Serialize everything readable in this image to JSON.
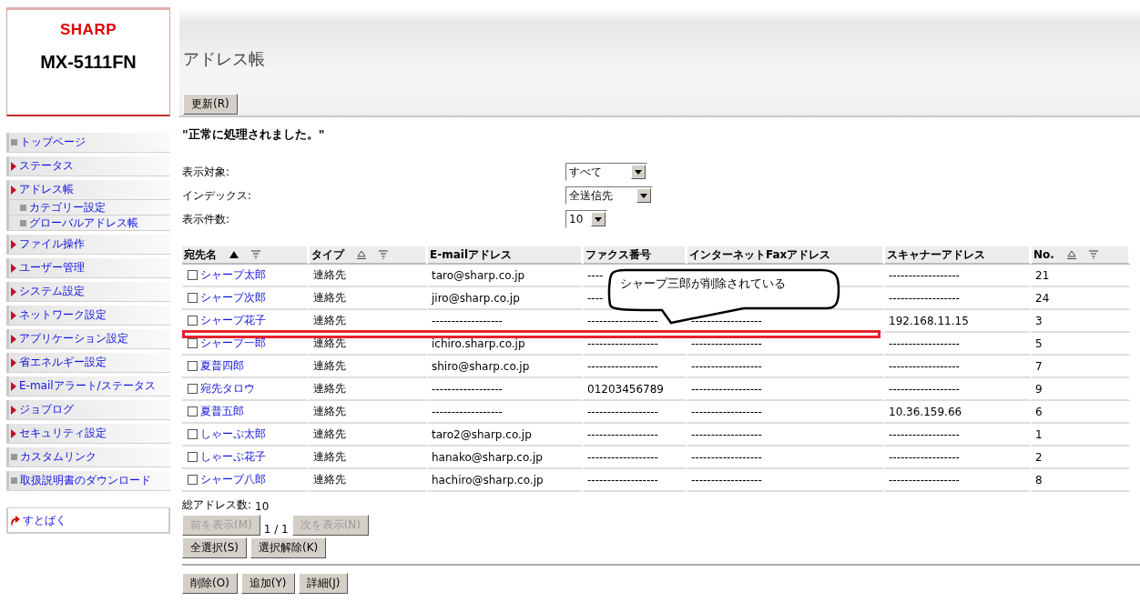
{
  "brand": {
    "logo": "SHARP",
    "model": "MX-5111FN"
  },
  "sidebar": {
    "items": [
      {
        "label": "トップページ",
        "kind": "square"
      },
      {
        "label": "ステータス",
        "kind": "arrow"
      },
      {
        "label": "アドレス帳",
        "kind": "arrow",
        "children": [
          {
            "label": "カテゴリー設定",
            "kind": "square"
          },
          {
            "label": "グローバルアドレス帳",
            "kind": "square"
          }
        ]
      },
      {
        "label": "ファイル操作",
        "kind": "arrow"
      },
      {
        "label": "ユーザー管理",
        "kind": "arrow"
      },
      {
        "label": "システム設定",
        "kind": "arrow"
      },
      {
        "label": "ネットワーク設定",
        "kind": "arrow"
      },
      {
        "label": "アプリケーション設定",
        "kind": "arrow"
      },
      {
        "label": "省エネルギー設定",
        "kind": "arrow"
      },
      {
        "label": "E-mailアラート/ステータス",
        "kind": "arrow"
      },
      {
        "label": "ジョブログ",
        "kind": "arrow"
      },
      {
        "label": "セキュリティ設定",
        "kind": "arrow"
      },
      {
        "label": "カスタムリンク",
        "kind": "square"
      },
      {
        "label": "取扱説明書のダウンロード",
        "kind": "square"
      }
    ],
    "link": "すとばく"
  },
  "page": {
    "title": "アドレス帳",
    "refresh_button": "更新(R)",
    "message": "\"正常に処理されました。\""
  },
  "filters": [
    {
      "label": "表示対象:",
      "value": "すべて"
    },
    {
      "label": "インデックス:",
      "value": "全送信先"
    },
    {
      "label": "表示件数:",
      "value": "10"
    }
  ],
  "table": {
    "columns": [
      {
        "label": "宛先名",
        "sorted": true
      },
      {
        "label": "タイプ",
        "sorted": false
      },
      {
        "label": "E-mailアドレス"
      },
      {
        "label": "ファクス番号"
      },
      {
        "label": "インターネットFaxアドレス"
      },
      {
        "label": "スキャナーアドレス"
      },
      {
        "label": "No.",
        "sorted": false
      }
    ],
    "rows": [
      {
        "checked": false,
        "name": "シャープ太郎",
        "type": "連絡先",
        "email": "taro@sharp.co.jp",
        "fax": "----",
        "scanner": "------------------",
        "no": "21"
      },
      {
        "checked": false,
        "name": "シャープ次郎",
        "type": "連絡先",
        "email": "jiro@sharp.co.jp",
        "fax": "----",
        "scanner": "------------------",
        "no": "24"
      },
      {
        "checked": false,
        "name": "シャープ花子",
        "type": "連絡先",
        "email": "------------------",
        "fax": "------------------",
        "ifax": "------------------",
        "scanner": "192.168.11.15",
        "no": "3"
      },
      {
        "checked": false,
        "name": "シャープ一郎",
        "type": "連絡先",
        "email": "ichiro.sharp.co.jp",
        "fax": "------------------",
        "ifax": "------------------",
        "scanner": "------------------",
        "no": "5"
      },
      {
        "checked": false,
        "name": "夏普四郎",
        "type": "連絡先",
        "email": "shiro@sharp.co.jp",
        "fax": "------------------",
        "ifax": "------------------",
        "scanner": "------------------",
        "no": "7"
      },
      {
        "checked": false,
        "name": "宛先タロウ",
        "type": "連絡先",
        "email": "------------------",
        "fax": "01203456789",
        "ifax": "------------------",
        "scanner": "------------------",
        "no": "9"
      },
      {
        "checked": false,
        "name": "夏普五郎",
        "type": "連絡先",
        "email": "------------------",
        "fax": "------------------",
        "ifax": "------------------",
        "scanner": "10.36.159.66",
        "no": "6"
      },
      {
        "checked": false,
        "name": "しゃーぷ太郎",
        "type": "連絡先",
        "email": "taro2@sharp.co.jp",
        "fax": "------------------",
        "ifax": "------------------",
        "scanner": "------------------",
        "no": "1"
      },
      {
        "checked": false,
        "name": "しゃーぷ花子",
        "type": "連絡先",
        "email": "hanako@sharp.co.jp",
        "fax": "------------------",
        "ifax": "------------------",
        "scanner": "------------------",
        "no": "2"
      },
      {
        "checked": false,
        "name": "シャープ八郎",
        "type": "連絡先",
        "email": "hachiro@sharp.co.jp",
        "fax": "------------------",
        "ifax": "------------------",
        "scanner": "------------------",
        "no": "8"
      }
    ]
  },
  "callout": "シャープ三郎が削除されている",
  "total": {
    "label": "総アドレス数:",
    "value": "10"
  },
  "pager": {
    "prev": {
      "label": "前を表示(M)",
      "disabled": true
    },
    "position": "1 / 1",
    "next": {
      "label": "次を表示(N)",
      "disabled": true
    }
  },
  "select_buttons": [
    {
      "label": "全選択(S)",
      "disabled": false
    },
    {
      "label": "選択解除(K)",
      "disabled": false
    }
  ],
  "action_buttons": [
    {
      "label": "削除(O)",
      "disabled": false
    },
    {
      "label": "追加(Y)",
      "disabled": false
    },
    {
      "label": "詳細(J)",
      "disabled": false
    }
  ]
}
